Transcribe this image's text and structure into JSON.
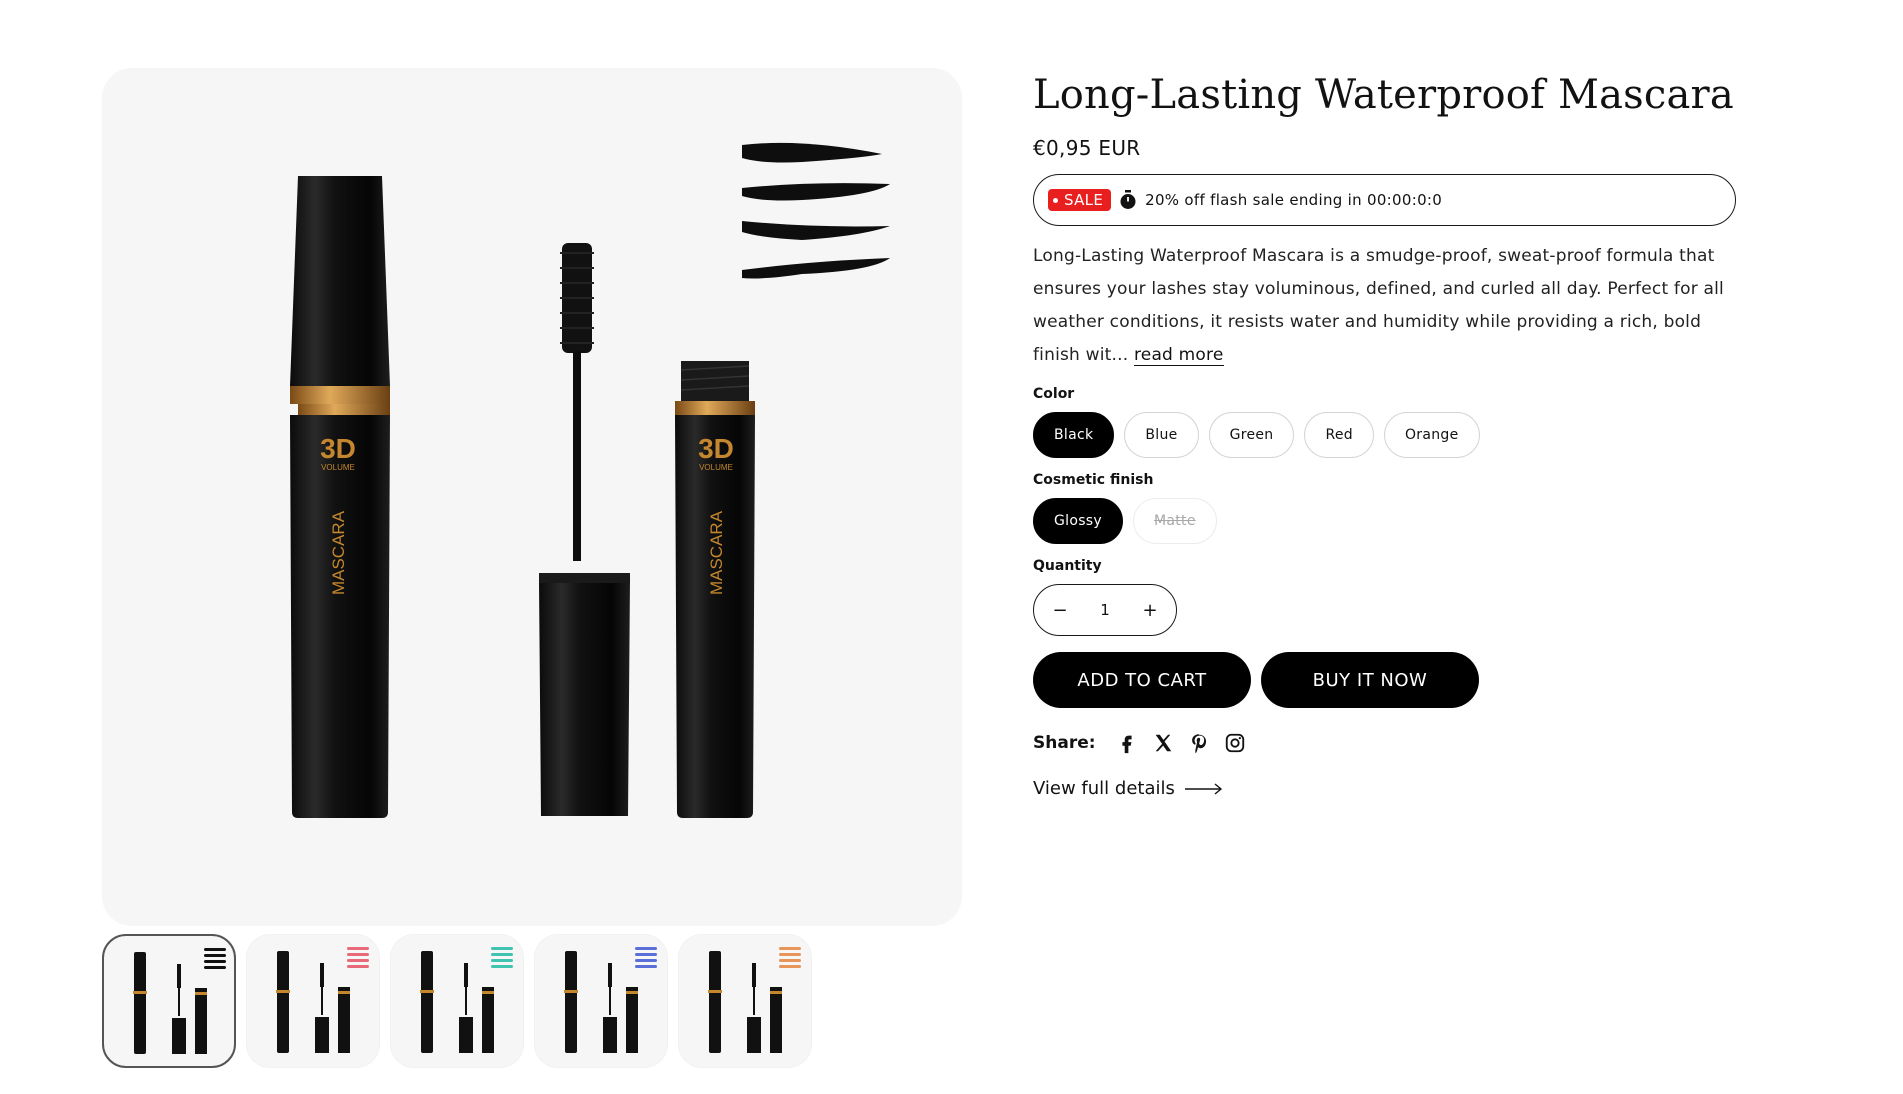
{
  "product": {
    "title": "Long-Lasting Waterproof Mascara",
    "price": "€0,95 EUR",
    "flash_sale": {
      "badge": "SALE",
      "text": "20% off flash sale ending in 00:00:0:0",
      "icon": "stopwatch-icon"
    },
    "description": "Long-Lasting Waterproof Mascara is a smudge-proof, sweat-proof formula that ensures your lashes stay voluminous, defined, and curled all day. Perfect for all weather conditions, it resists water and humidity while providing a rich, bold finish wit...",
    "read_more": "read more",
    "image_text": {
      "volume_mark": "3D",
      "volume_word": "VOLUME",
      "brand_word": "MASCARA"
    }
  },
  "options": {
    "color": {
      "label": "Color",
      "values": [
        "Black",
        "Blue",
        "Green",
        "Red",
        "Orange"
      ],
      "selected": "Black"
    },
    "finish": {
      "label": "Cosmetic finish",
      "values": [
        "Glossy",
        "Matte"
      ],
      "selected": "Glossy",
      "unavailable": [
        "Matte"
      ]
    }
  },
  "quantity": {
    "label": "Quantity",
    "value": "1",
    "minus": "−",
    "plus": "+"
  },
  "buttons": {
    "add_to_cart": "ADD TO CART",
    "buy_now": "BUY IT NOW"
  },
  "share": {
    "label": "Share:",
    "icons": [
      "facebook-icon",
      "x-icon",
      "pinterest-icon",
      "instagram-icon"
    ]
  },
  "view_details": "View full details",
  "thumbnails": [
    {
      "swatch": "#111111"
    },
    {
      "swatch": "#e86a78"
    },
    {
      "swatch": "#3ec4b0"
    },
    {
      "swatch": "#5b6fd8"
    },
    {
      "swatch": "#e8955a"
    }
  ],
  "colors": {
    "sale_red": "#e91e1e",
    "button_black": "#000000",
    "gold_accent": "#c4862e"
  }
}
